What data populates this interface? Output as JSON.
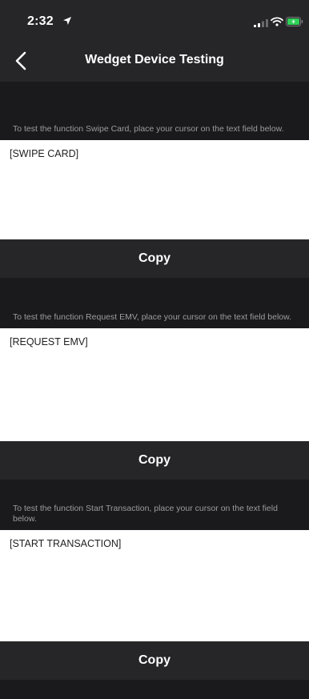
{
  "status_bar": {
    "time": "2:32",
    "location_icon": "location-arrow-icon",
    "signal_icon": "cellular-signal-icon",
    "wifi_icon": "wifi-icon",
    "battery_icon": "battery-charging-icon",
    "battery_color": "#30d158"
  },
  "nav": {
    "back_icon": "chevron-left-icon",
    "title": "Wedget Device Testing"
  },
  "sections": [
    {
      "instruction": "To test the function Swipe Card, place your cursor on the text field below.",
      "field_value": "[SWIPE CARD]",
      "copy_label": "Copy"
    },
    {
      "instruction": "To test the function Request EMV, place your cursor on the text field below.",
      "field_value": "[REQUEST EMV]",
      "copy_label": "Copy"
    },
    {
      "instruction": "To test the function Start Transaction, place your cursor on the text field below.",
      "field_value": "[START TRANSACTION]",
      "copy_label": "Copy"
    }
  ],
  "colors": {
    "background": "#1a1a1c",
    "bar": "#262628",
    "instruction_text": "#9c9ca0",
    "field_background": "#ffffff"
  }
}
